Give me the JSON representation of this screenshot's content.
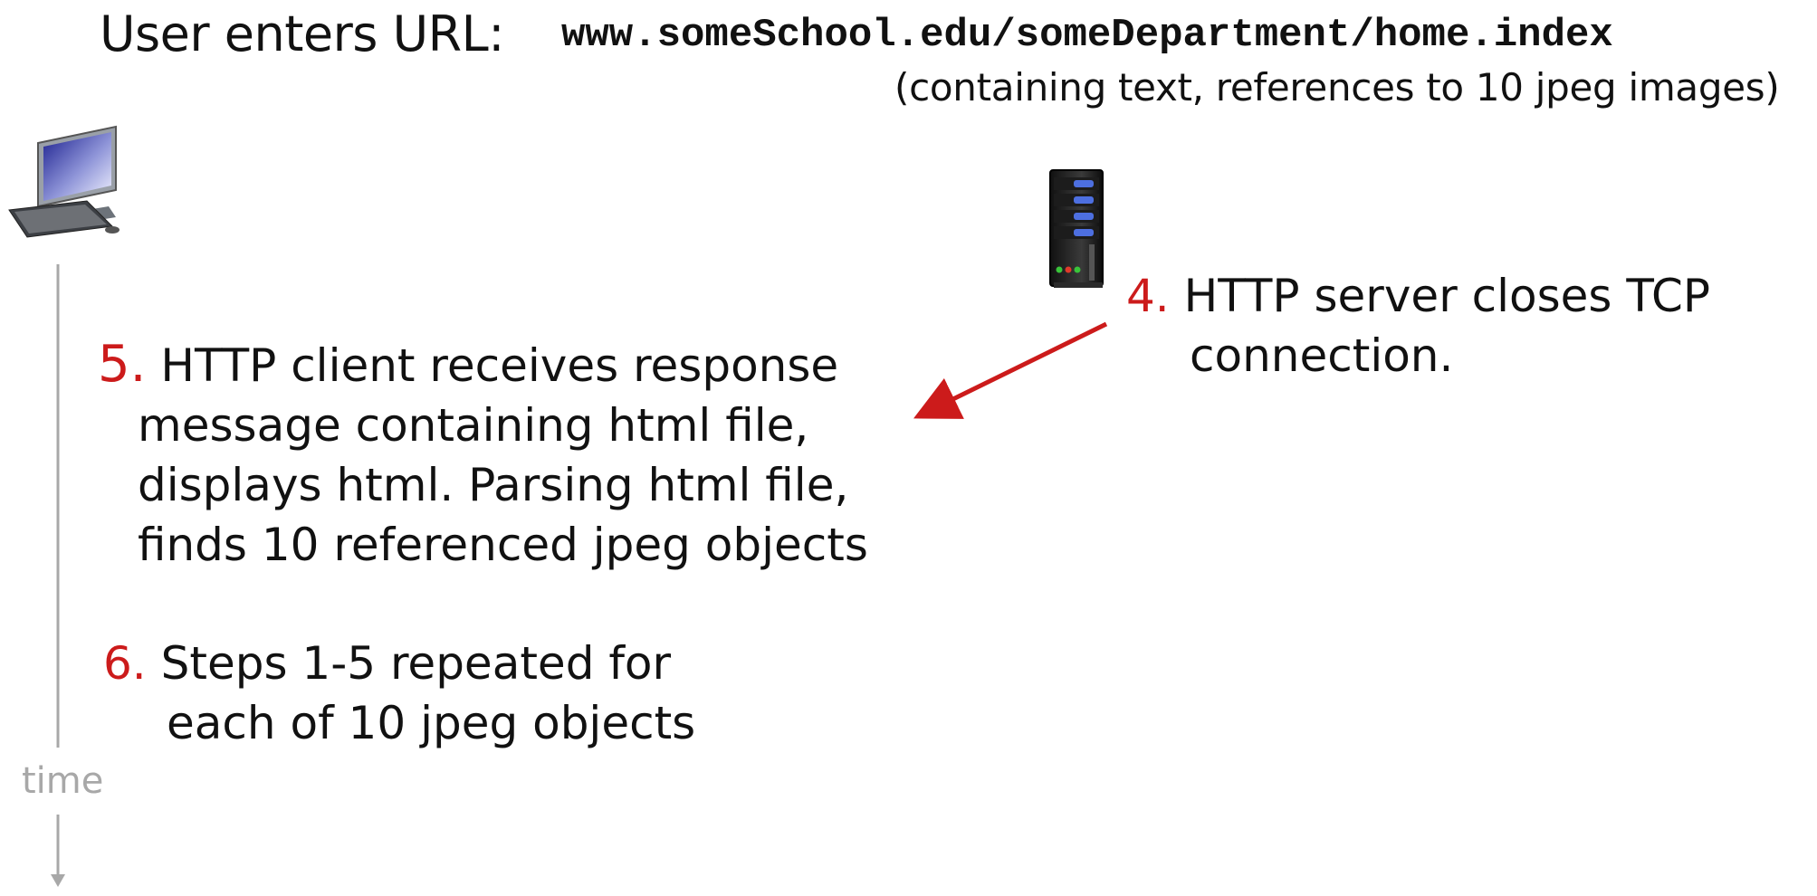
{
  "header": {
    "prefix": "User enters URL:",
    "url": "www.someSchool.edu/someDepartment/home.index",
    "subtitle": "(containing text, references to 10 jpeg images)"
  },
  "steps": [
    {
      "number": "4.",
      "line1": "HTTP server closes TCP",
      "line2": "connection."
    },
    {
      "number": "5.",
      "line1": "HTTP client receives response",
      "line2": "message containing html file,",
      "line3": "displays html.  Parsing html file,",
      "line4": "finds 10 referenced jpeg  objects"
    },
    {
      "number": "6.",
      "line1": "Steps 1-5 repeated for",
      "line2": "each of 10 jpeg objects"
    }
  ],
  "timeline": {
    "label": "time"
  },
  "icons": {
    "client": "desktop-computer-icon",
    "server": "server-tower-icon"
  },
  "colors": {
    "step_number": "#cc1b1b",
    "arrow": "#cc1b1b",
    "timeline": "#a8a8a8"
  }
}
